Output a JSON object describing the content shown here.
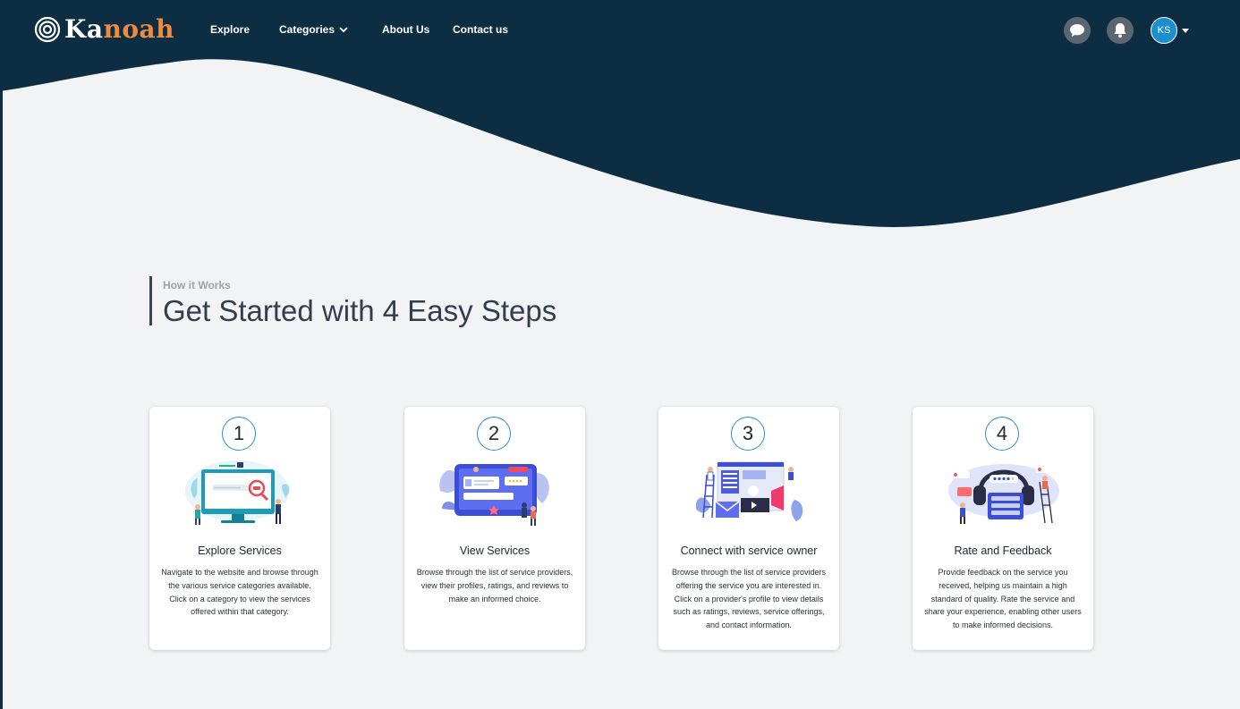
{
  "colors": {
    "navy": "#0c2d42",
    "accent_orange": "#f08a3e",
    "page_bg": "#f2f3f5",
    "step_ring": "#2b8fd6",
    "avatar_bg": "#1c8fcf"
  },
  "brand": {
    "logo_prefix": "Ka",
    "logo_suffix": "noah",
    "icon": "target-logo-icon"
  },
  "nav": {
    "explore": "Explore",
    "categories": "Categories",
    "about": "About Us",
    "contact": "Contact us"
  },
  "header_actions": {
    "chat_icon": "chat-bubble-icon",
    "bell_icon": "bell-icon",
    "avatar_initials": "KS"
  },
  "section": {
    "eyebrow": "How it Works",
    "title": "Get Started with 4 Easy Steps"
  },
  "steps": [
    {
      "number": "1",
      "title": "Explore Services",
      "description": "Navigate to the website and browse through the various service categories available. Click on a category to view the services offered within that category.",
      "illustration": "search-screen-illustration"
    },
    {
      "number": "2",
      "title": "View Services",
      "description": "Browse through the list of service providers, view their profiles, ratings, and reviews to make an informed choice.",
      "illustration": "profiles-screen-illustration"
    },
    {
      "number": "3",
      "title": "Connect with service owner",
      "description": "Browse through the list of service providers offering the service you are interested in. Click on a provider's profile to view details such as ratings, reviews, service offerings, and contact information.",
      "illustration": "connect-screen-illustration"
    },
    {
      "number": "4",
      "title": "Rate and Feedback",
      "description": "Provide feedback on the service you received, helping us maintain a high standard of quality. Rate the service and share your experience, enabling other users to make informed decisions.",
      "illustration": "feedback-headset-illustration"
    }
  ]
}
